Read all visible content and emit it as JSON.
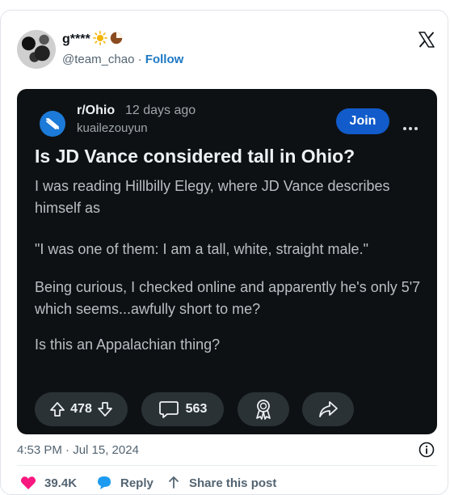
{
  "tweet": {
    "display_name": "g****",
    "handle": "@team_chao",
    "separator": " · ",
    "follow_label": "Follow",
    "timestamp": "4:53 PM · Jul 15, 2024"
  },
  "reddit_post": {
    "subreddit": "r/Ohio",
    "age": "12 days ago",
    "username": "kuailezouyun",
    "join_label": "Join",
    "title": "Is JD Vance considered tall in Ohio?",
    "paragraphs": [
      "I was reading Hillbilly Elegy, where JD Vance describes himself as",
      "\"I was one of them: I am a tall, white, straight male.\"",
      "Being curious, I checked online and apparently he's only 5'7 which seems...awfully short to me?",
      "Is this an Appalachian thing?"
    ],
    "votes": "478",
    "comments": "563"
  },
  "footer": {
    "likes": "39.4K",
    "reply_label": "Reply",
    "share_label": "Share this post"
  },
  "colors": {
    "reddit_card_bg": "#0e1113",
    "join_blue": "#115bca",
    "follow_blue": "#1d78c5",
    "like_pink": "#f91880",
    "reply_blue": "#1d9bf0"
  }
}
